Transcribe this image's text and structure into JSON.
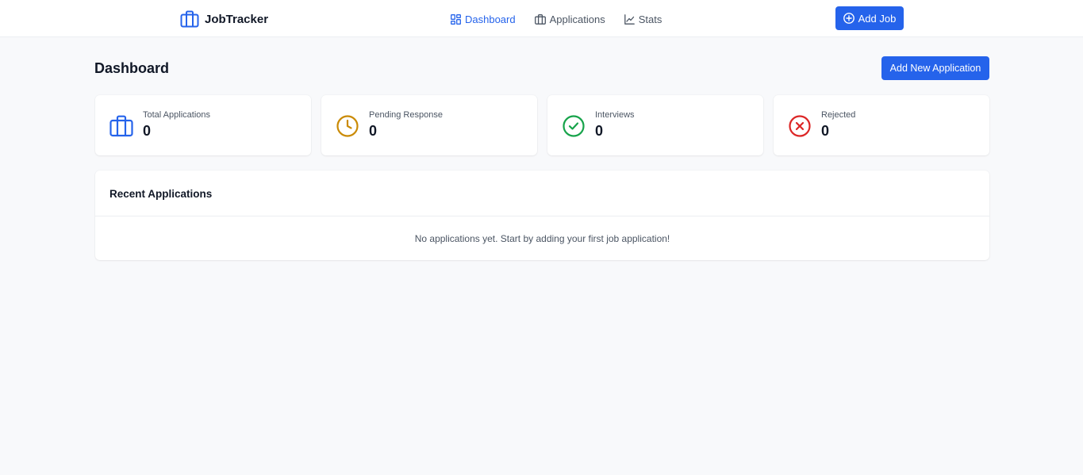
{
  "brand": {
    "name": "JobTracker",
    "icon": "briefcase-icon"
  },
  "nav": {
    "items": [
      {
        "label": "Dashboard",
        "icon": "grid-icon",
        "active": true
      },
      {
        "label": "Applications",
        "icon": "briefcase-icon",
        "active": false
      },
      {
        "label": "Stats",
        "icon": "line-chart-icon",
        "active": false
      }
    ],
    "add_job_label": "Add Job"
  },
  "header": {
    "title": "Dashboard",
    "add_application_label": "Add New Application"
  },
  "stats": [
    {
      "label": "Total Applications",
      "value": "0",
      "icon": "briefcase-icon",
      "color": "#2563eb"
    },
    {
      "label": "Pending Response",
      "value": "0",
      "icon": "clock-icon",
      "color": "#ca8a04"
    },
    {
      "label": "Interviews",
      "value": "0",
      "icon": "check-circle-icon",
      "color": "#16a34a"
    },
    {
      "label": "Rejected",
      "value": "0",
      "icon": "x-circle-icon",
      "color": "#dc2626"
    }
  ],
  "recent": {
    "title": "Recent Applications",
    "empty_message": "No applications yet. Start by adding your first job application!"
  },
  "colors": {
    "accent": "#2563eb",
    "background": "#f8f9fb"
  }
}
